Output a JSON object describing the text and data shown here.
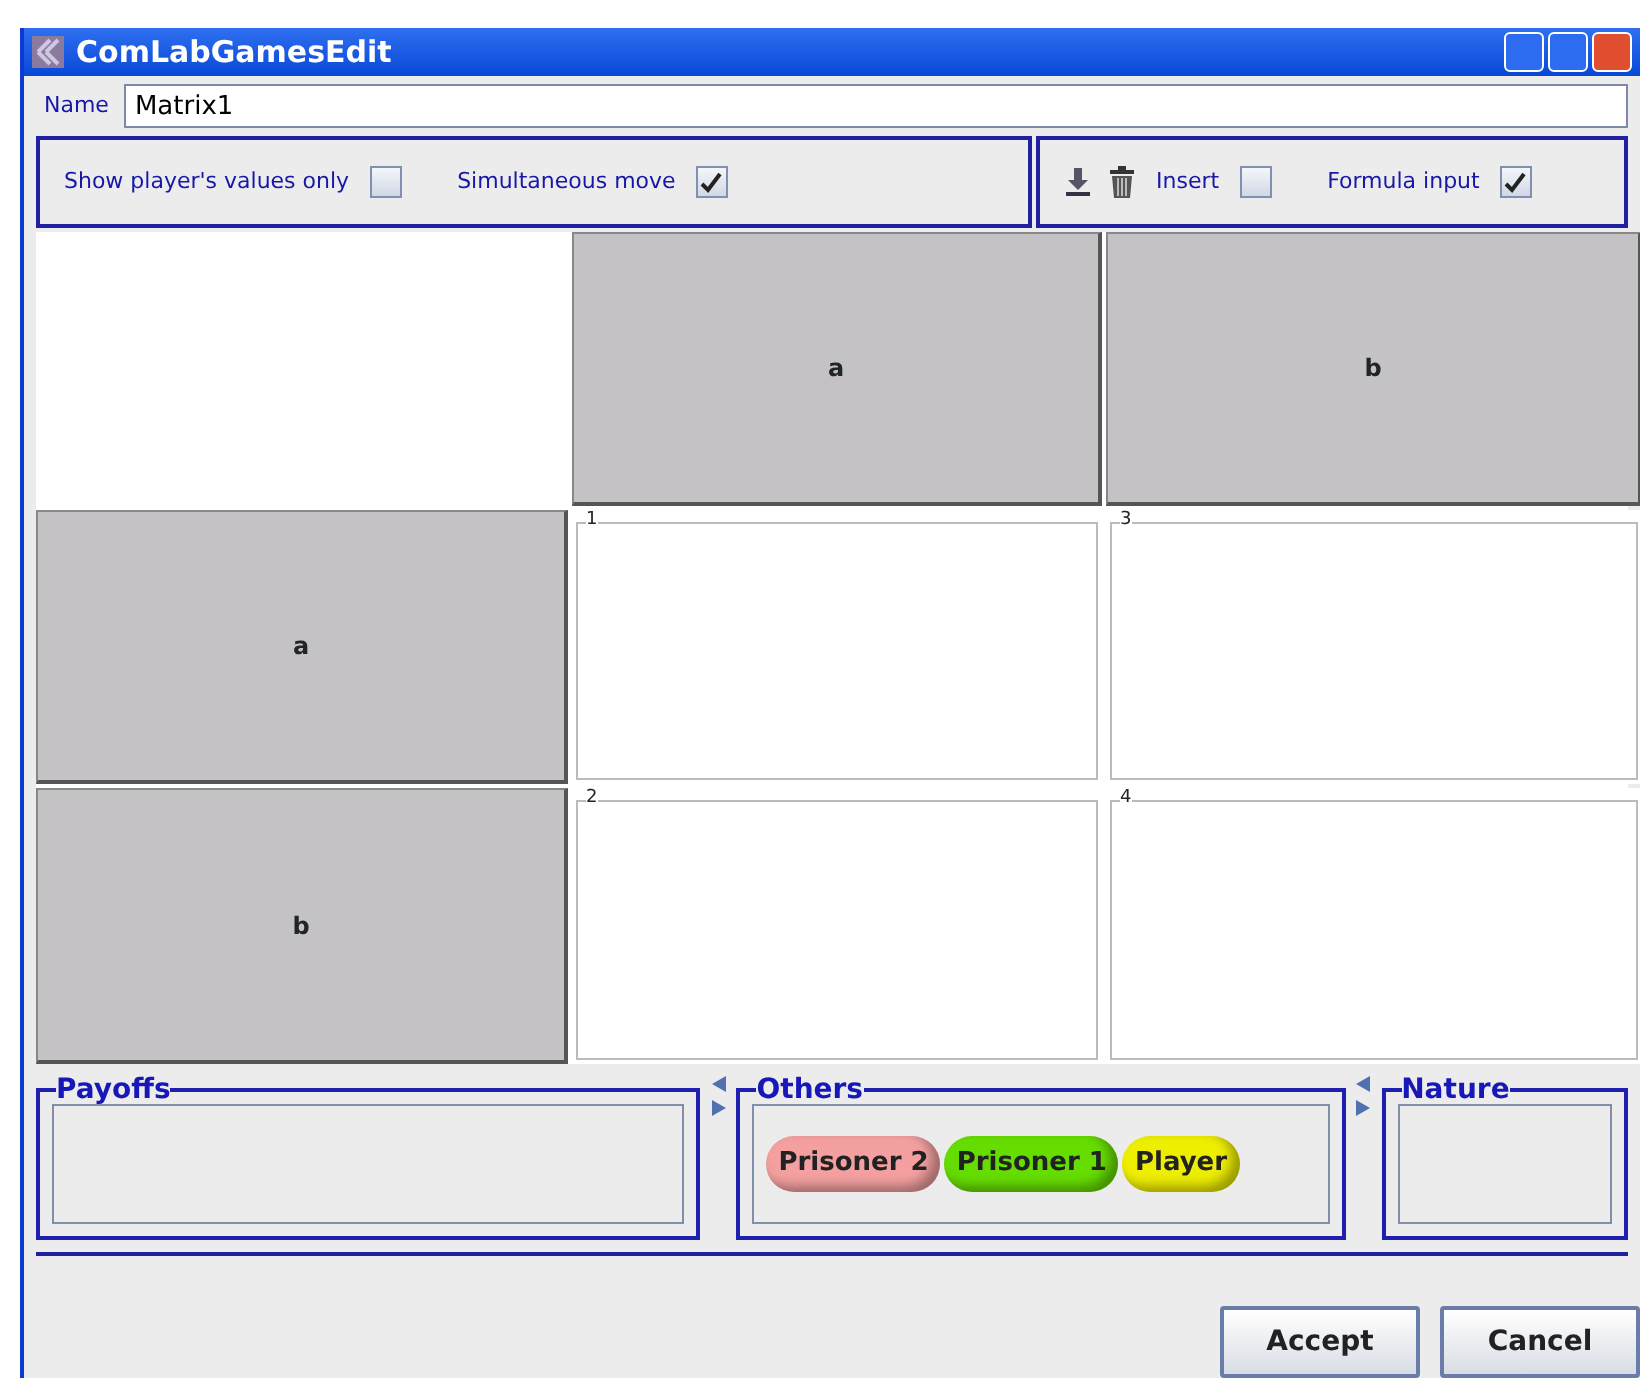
{
  "window": {
    "title": "ComLabGamesEdit"
  },
  "name_field": {
    "label": "Name",
    "value": "Matrix1"
  },
  "options": [
    {
      "label": "Show player's values only",
      "checked": false
    },
    {
      "label": "Simultaneous move",
      "checked": true
    }
  ],
  "edit_options": [
    {
      "label": "Insert",
      "checked": false
    },
    {
      "label": "Formula input",
      "checked": true
    }
  ],
  "matrix": {
    "columns": [
      "a",
      "b"
    ],
    "rows": [
      {
        "label": "a",
        "cells": [
          "1",
          "3"
        ]
      },
      {
        "label": "b",
        "cells": [
          "2",
          "4"
        ]
      }
    ]
  },
  "payoffs": {
    "title": "Payoffs"
  },
  "others": {
    "title": "Others",
    "players": [
      {
        "name": "Prisoner 2",
        "color": "#f4a0a0"
      },
      {
        "name": "Prisoner 1",
        "color": "#66dd00"
      },
      {
        "name": "Player",
        "color": "#eeee00"
      }
    ]
  },
  "nature": {
    "title": "Nature"
  },
  "buttons": [
    "Accept",
    "Cancel"
  ]
}
